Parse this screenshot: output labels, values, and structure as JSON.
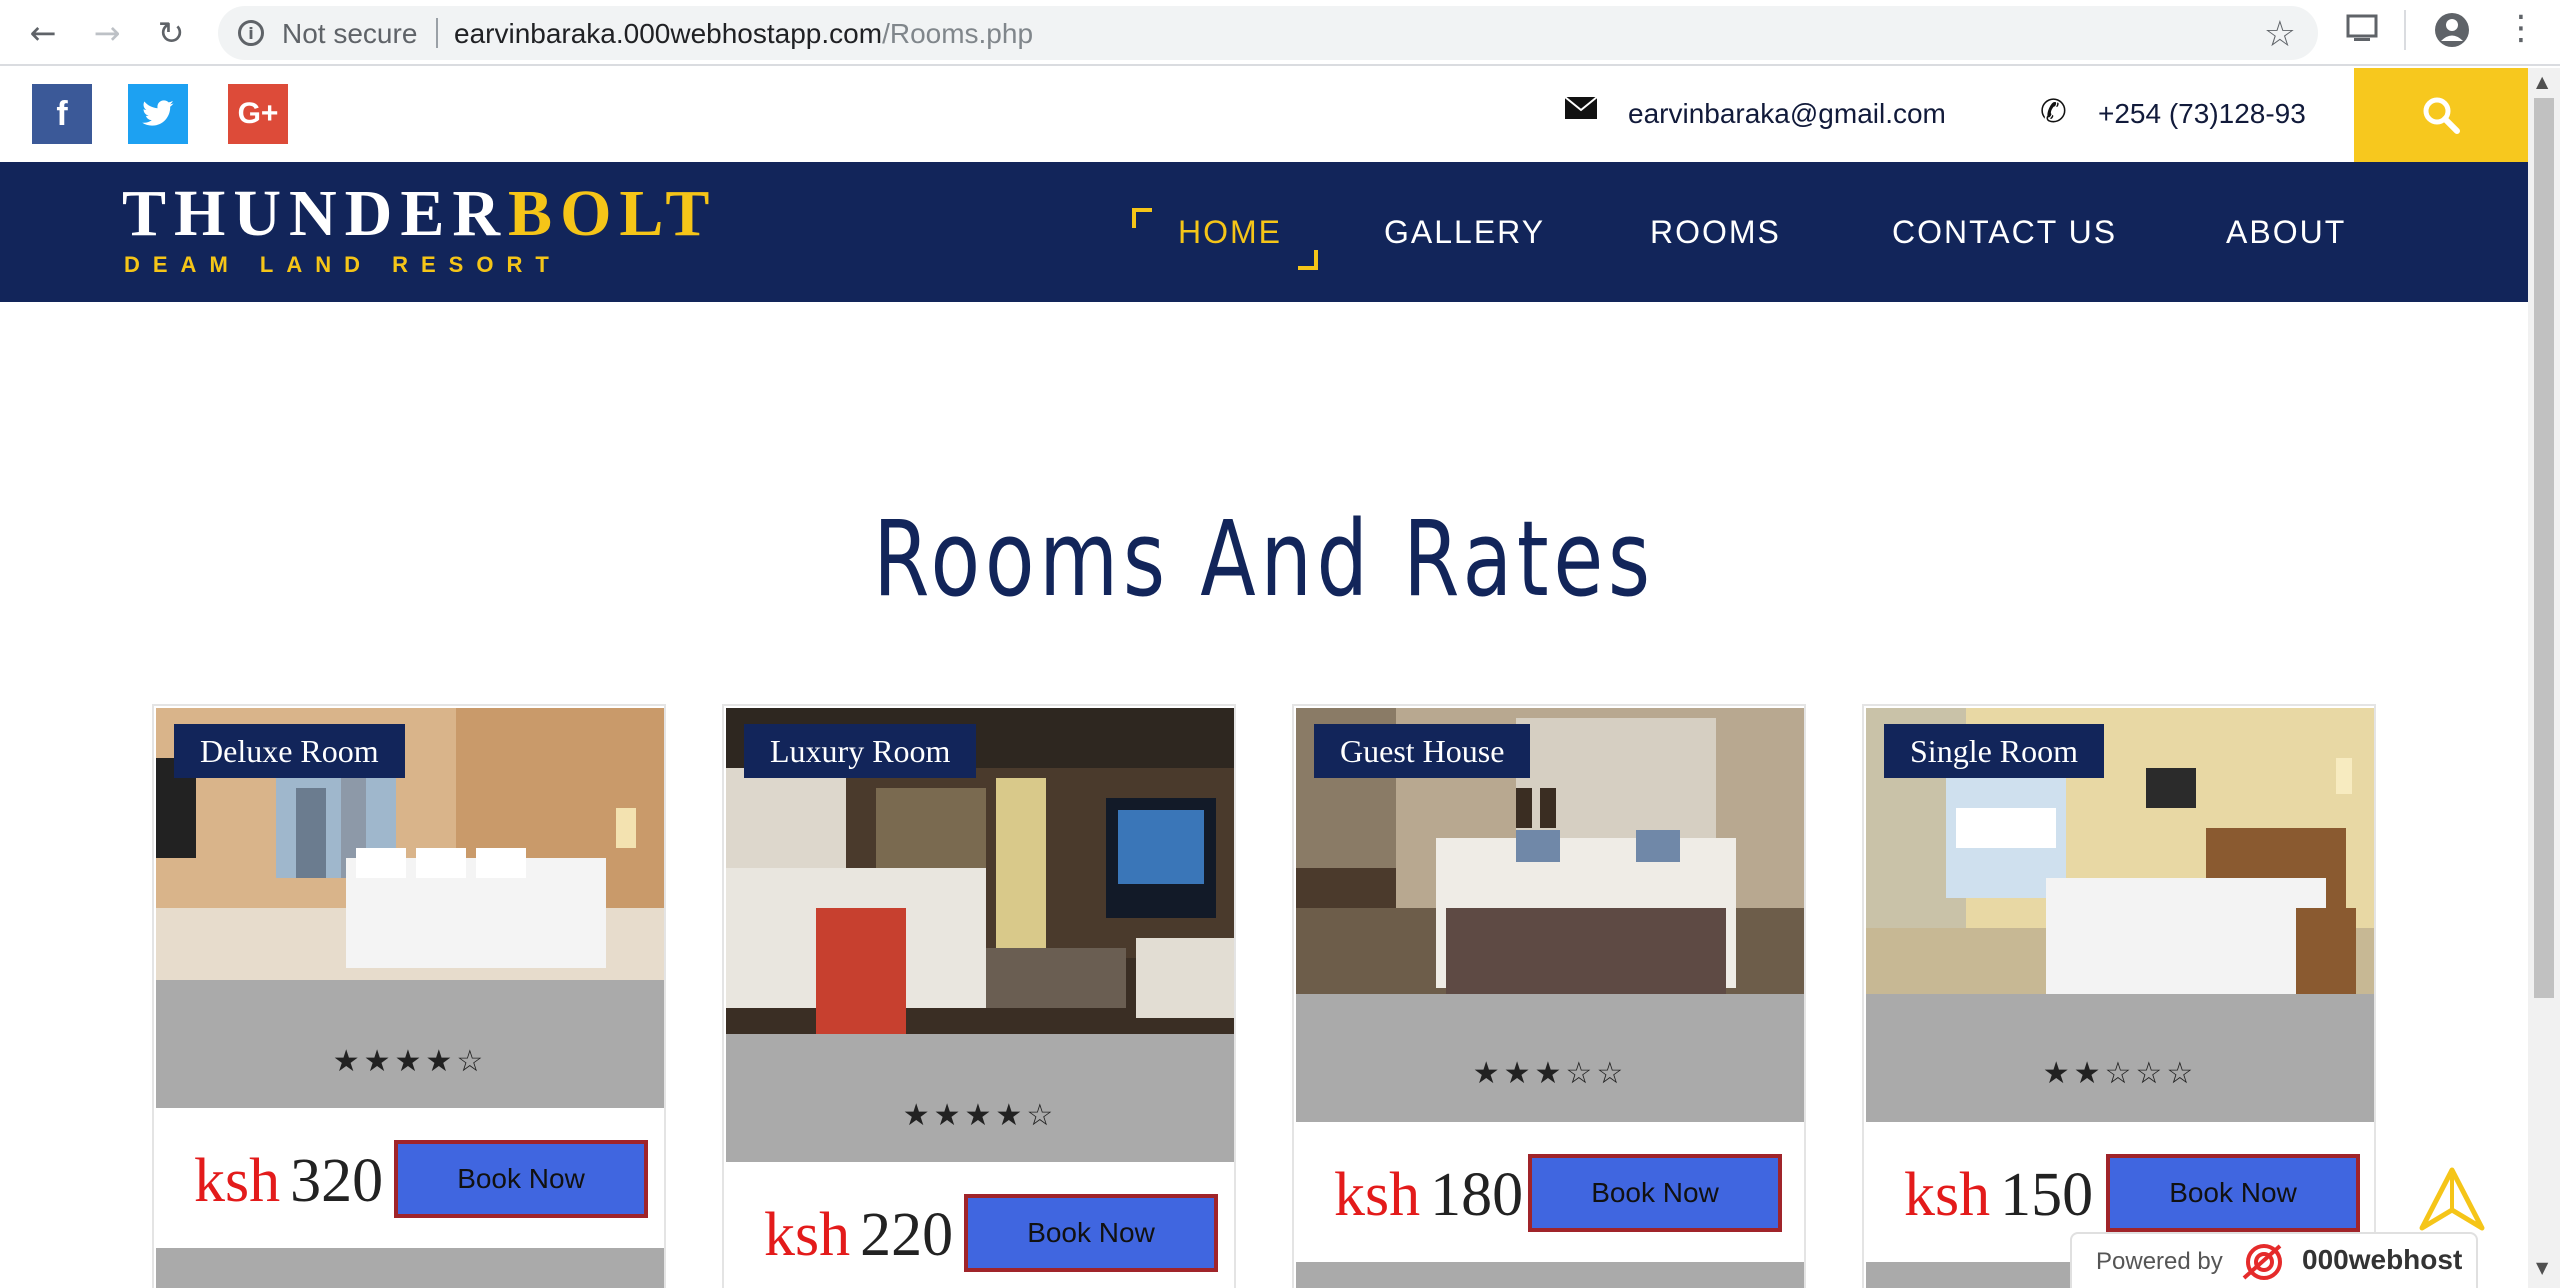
{
  "browser": {
    "not_secure": "Not secure",
    "url_domain": "earvinbaraka.000webhostapp.com",
    "url_path": "/Rooms.php"
  },
  "topbar": {
    "social": [
      {
        "name": "facebook",
        "glyph": "f",
        "color": "#3b5998"
      },
      {
        "name": "twitter",
        "glyph": "t",
        "color": "#1da1f2"
      },
      {
        "name": "google-plus",
        "glyph": "G+",
        "color": "#dd4b39"
      }
    ],
    "email": "earvinbaraka@gmail.com",
    "phone": "+254 (73)128-93"
  },
  "navbar": {
    "logo_white": "THUNDER",
    "logo_yellow": "BOLT",
    "logo_sub": "DEAM LAND RESORT",
    "items": [
      "HOME",
      "GALLERY",
      "ROOMS",
      "CONTACT US",
      "ABOUT"
    ],
    "active": "HOME"
  },
  "main": {
    "heading": "Rooms And Rates",
    "rooms": [
      {
        "name": "Deluxe Room",
        "rating": 4,
        "stars": "★★★★☆",
        "currency": "ksh",
        "price": "320",
        "button": "Book Now"
      },
      {
        "name": "Luxury Room",
        "rating": 4,
        "stars": "★★★★☆",
        "currency": "ksh",
        "price": "220",
        "button": "Book Now"
      },
      {
        "name": "Guest House",
        "rating": 3,
        "stars": "★★★☆☆",
        "currency": "ksh",
        "price": "180",
        "button": "Book Now"
      },
      {
        "name": "Single Room",
        "rating": 2,
        "stars": "★★☆☆☆",
        "currency": "ksh",
        "price": "150",
        "button": "Book Now"
      }
    ]
  },
  "footer_badge": {
    "powered_by": "Powered by",
    "brand": "000webhost"
  },
  "colors": {
    "navy": "#12255a",
    "yellow": "#f5c518",
    "button_blue": "#4066e0",
    "button_border": "#a0242a",
    "price_red": "#e31b1b"
  }
}
